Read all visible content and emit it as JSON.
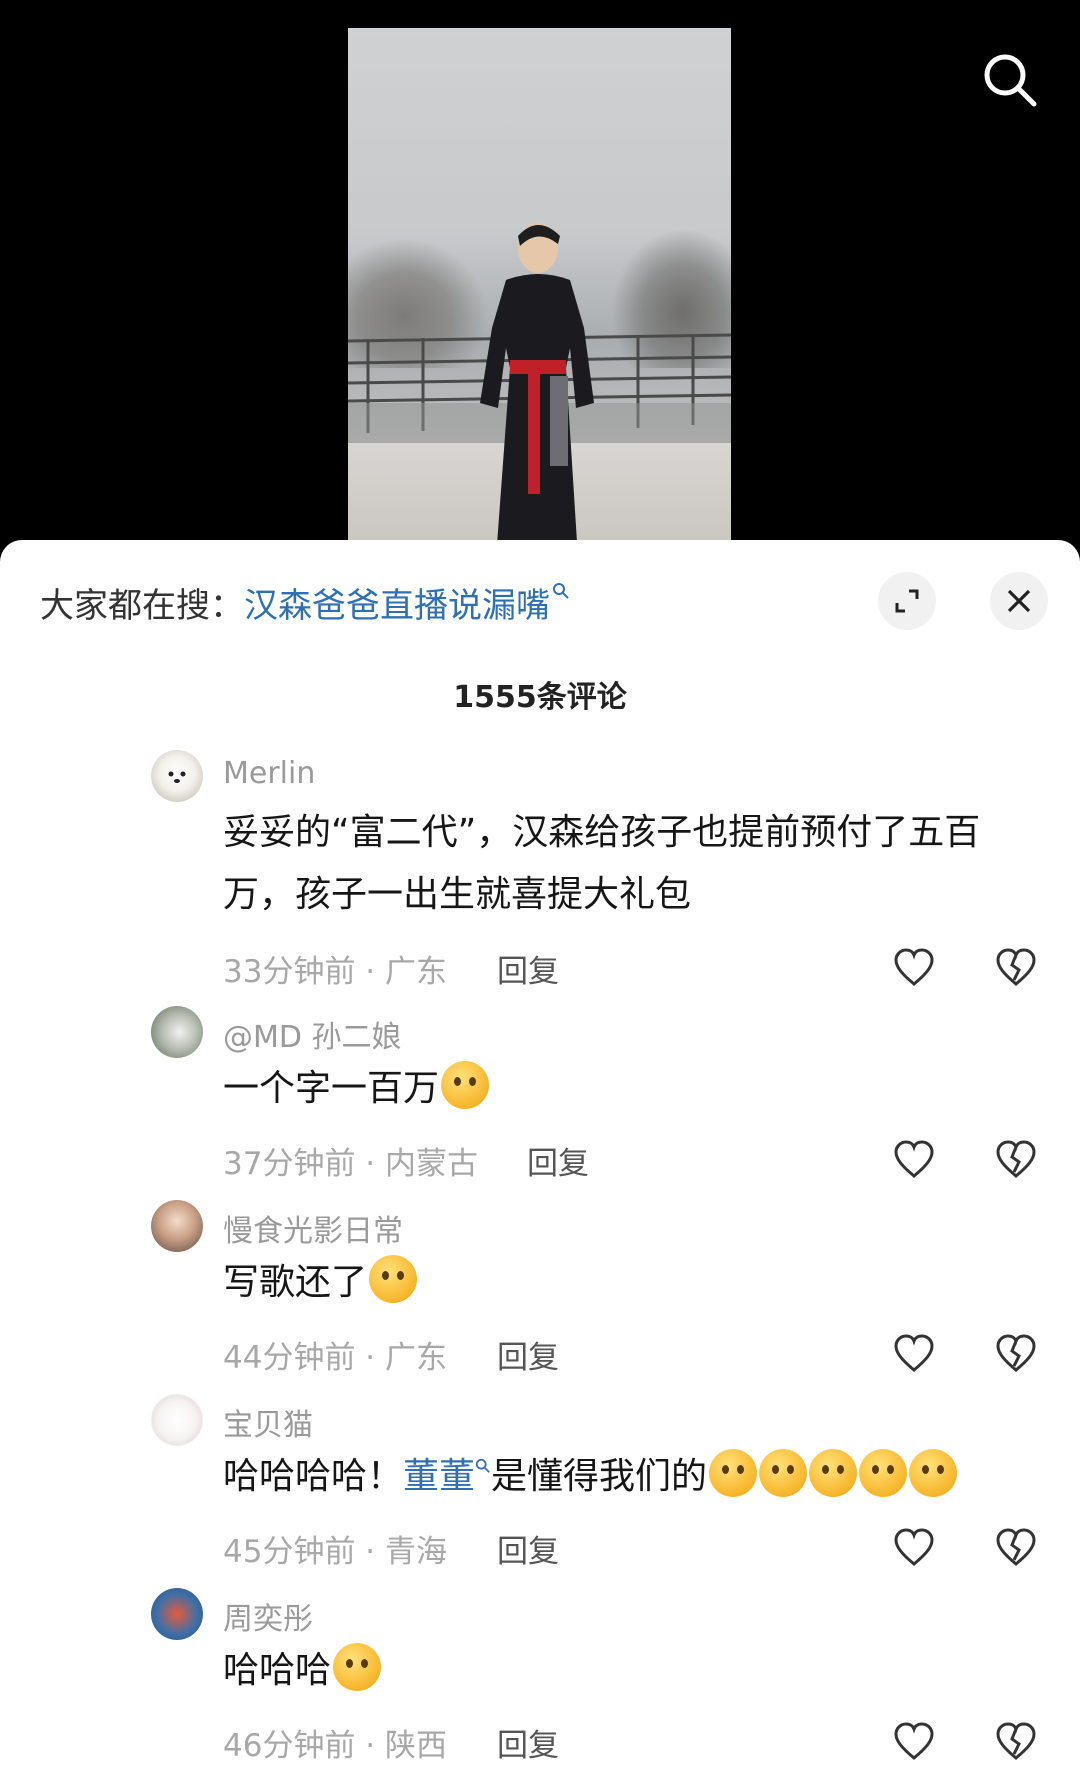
{
  "top_bar": {
    "search_icon": "search-icon"
  },
  "sheet": {
    "trending_prefix": "大家都在搜：",
    "trending_term": "汉森爸爸直播说漏嘴",
    "expand_icon": "expand-icon",
    "close_icon": "close-icon",
    "comment_count": "1555条评论"
  },
  "comments": [
    {
      "user": "Merlin",
      "text": "妥妥的“富二代”，汉森给孩子也提前预付了五百万，孩子一出生就喜提大礼包",
      "time_location": "33分钟前 · 广东",
      "reply": "回复"
    },
    {
      "user": "@MD 孙二娘",
      "text": "一个字一百万",
      "emoji": "pleading-emoji",
      "time_location": "37分钟前 · 内蒙古",
      "reply": "回复"
    },
    {
      "user": "慢食光影日常",
      "text": "写歌还了",
      "emoji": "grinning-emoji",
      "time_location": "44分钟前 · 广东",
      "reply": "回复"
    },
    {
      "user": "宝贝猫",
      "text_before": "哈哈哈哈！",
      "link": "董董",
      "text_after": "是懂得我们的",
      "emoji": "blushing-emoji",
      "time_location": "45分钟前 · 青海",
      "reply": "回复"
    },
    {
      "user": "周奕彤",
      "text": "哈哈哈",
      "emoji": "tears-of-joy-emoji",
      "time_location": "46分钟前 · 陕西",
      "reply": "回复"
    }
  ],
  "colors": {
    "link": "#2f6fb3",
    "meta": "#a8a8a8",
    "background": "#ffffff"
  }
}
